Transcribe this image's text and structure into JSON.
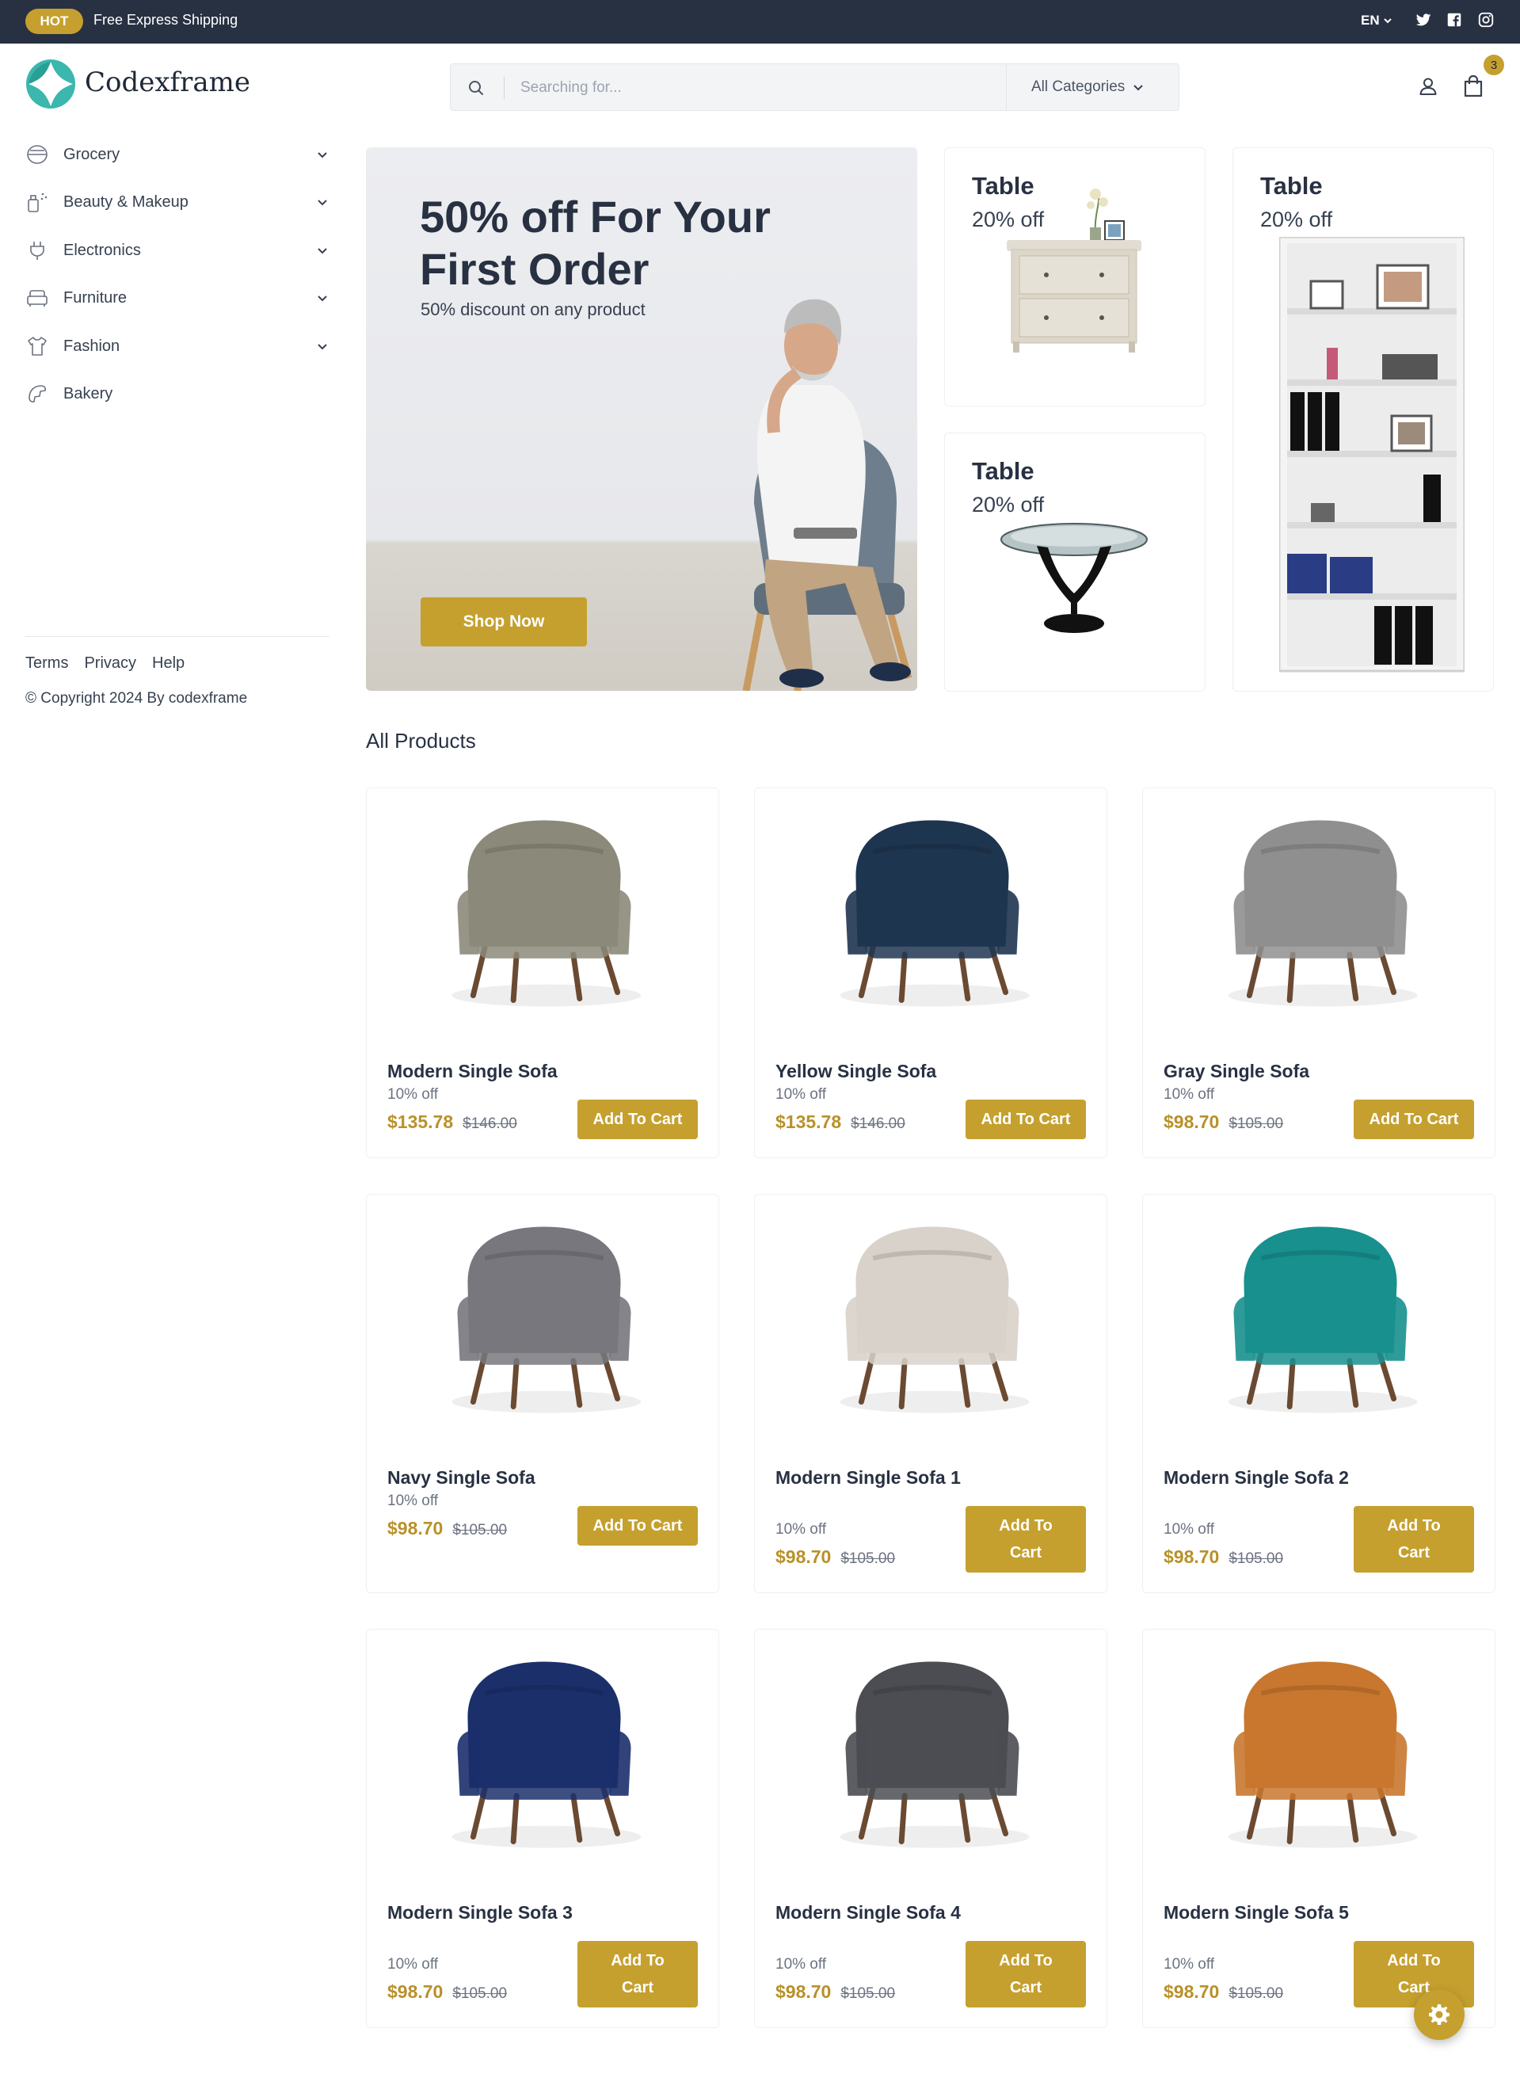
{
  "topbar": {
    "hot_label": "HOT",
    "shipping_text": "Free Express Shipping",
    "language": "EN"
  },
  "header": {
    "brand": "Codexframe",
    "search_placeholder": "Searching for...",
    "category_select": "All Categories",
    "cart_count": "3"
  },
  "sidebar": {
    "items": [
      {
        "label": "Grocery",
        "icon": "grocery-icon",
        "has_children": true
      },
      {
        "label": "Beauty & Makeup",
        "icon": "beauty-icon",
        "has_children": true
      },
      {
        "label": "Electronics",
        "icon": "plug-icon",
        "has_children": true
      },
      {
        "label": "Furniture",
        "icon": "sofa-icon",
        "has_children": true
      },
      {
        "label": "Fashion",
        "icon": "shirt-icon",
        "has_children": true
      },
      {
        "label": "Bakery",
        "icon": "croissant-icon",
        "has_children": false
      }
    ],
    "footer_links": [
      "Terms",
      "Privacy",
      "Help"
    ],
    "copyright": "© Copyright 2024 By codexframe"
  },
  "hero": {
    "title": "50% off For Your First Order",
    "subtitle": "50% discount on any product",
    "button_label": "Shop Now"
  },
  "promos": [
    {
      "title": "Table",
      "discount": "20% off"
    },
    {
      "title": "Table",
      "discount": "20% off"
    },
    {
      "title": "Table",
      "discount": "20% off"
    }
  ],
  "products_section": {
    "title": "All Products",
    "add_to_cart_label": "Add To Cart",
    "items": [
      {
        "name": "Modern Single Sofa",
        "discount": "10% off",
        "price": "$135.78",
        "old_price": "$146.00",
        "color": "#8b8a7a"
      },
      {
        "name": "Yellow Single Sofa",
        "discount": "10% off",
        "price": "$135.78",
        "old_price": "$146.00",
        "color": "#1e3550"
      },
      {
        "name": "Gray Single Sofa",
        "discount": "10% off",
        "price": "$98.70",
        "old_price": "$105.00",
        "color": "#8f8f8f"
      },
      {
        "name": "Navy Single Sofa",
        "discount": "10% off",
        "price": "$98.70",
        "old_price": "$105.00",
        "color": "#77777d"
      },
      {
        "name": "Modern Single Sofa 1",
        "discount": "10% off",
        "price": "$98.70",
        "old_price": "$105.00",
        "color": "#d8d2ca"
      },
      {
        "name": "Modern Single Sofa 2",
        "discount": "10% off",
        "price": "$98.70",
        "old_price": "$105.00",
        "color": "#17908e"
      },
      {
        "name": "Modern Single Sofa 3",
        "discount": "10% off",
        "price": "$98.70",
        "old_price": "$105.00",
        "color": "#1b2f6b"
      },
      {
        "name": "Modern Single Sofa 4",
        "discount": "10% off",
        "price": "$98.70",
        "old_price": "$105.00",
        "color": "#4b4d52"
      },
      {
        "name": "Modern Single Sofa 5",
        "discount": "10% off",
        "price": "$98.70",
        "old_price": "$105.00",
        "color": "#c9772e"
      }
    ]
  },
  "colors": {
    "accent": "#c5a02f",
    "topbar": "#283142",
    "price": "#b8912a"
  }
}
